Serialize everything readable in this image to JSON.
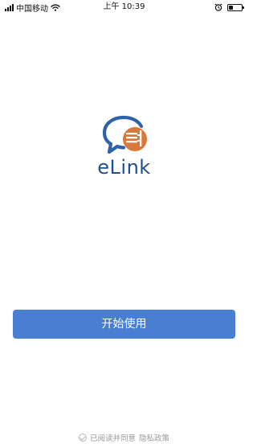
{
  "status_bar": {
    "carrier": "中国移动",
    "time": "上午 10:39",
    "battery_level": 0.35
  },
  "logo": {
    "text": "eLink",
    "colors": {
      "bubble_blue": "#2d63a9",
      "badge_orange": "#d9783a",
      "text_navy": "#1e4f8f"
    }
  },
  "start": {
    "label": "开始使用",
    "color": "#4a7ed1"
  },
  "privacy": {
    "agreed_text": "已阅读并同意",
    "policy_link": "隐私政策"
  },
  "icons": {
    "signal": "signal-icon",
    "wifi": "wifi-icon",
    "alarm": "alarm-icon",
    "battery": "battery-icon",
    "check": "check-circle-icon",
    "logo": "elink-logo-icon"
  }
}
